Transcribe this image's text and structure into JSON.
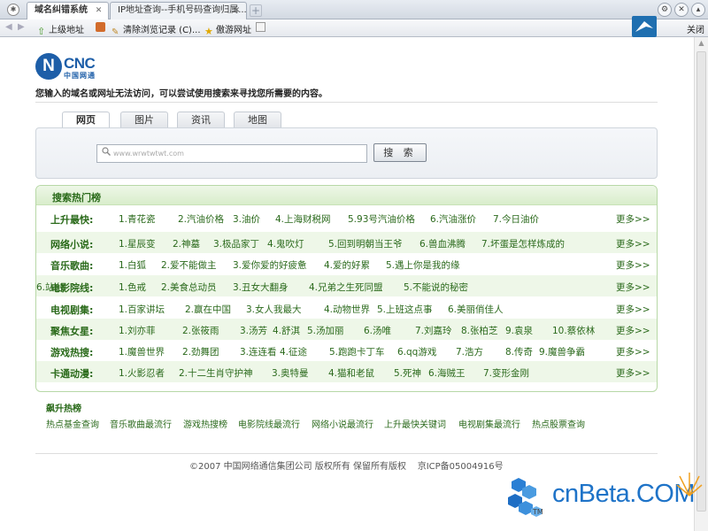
{
  "browser": {
    "tabs": [
      {
        "label": "域名纠错系统",
        "active": true
      },
      {
        "label": "IP地址查询--手机号码查询归属...",
        "active": false
      }
    ],
    "toolbar": {
      "items": [
        "上级地址",
        "清除浏览记录 (C)...",
        "傲游网址"
      ],
      "close_label": "关闭"
    }
  },
  "page": {
    "logo": {
      "mark": "N",
      "brand": "CNC",
      "cn": "中国网通"
    },
    "notice": "您输入的域名或网址无法访问，可以尝试使用搜索来寻找您所需要的内容。",
    "search": {
      "tabs": [
        "网页",
        "图片",
        "资讯",
        "地图"
      ],
      "active_tab": "网页",
      "input_value": "www.wrwtwtwt.com",
      "button_label": "搜 索"
    },
    "hot": {
      "title": "搜索热门榜",
      "more_label": "更多>>",
      "rows": [
        {
          "label": "上升最快:",
          "items": [
            "1.青花瓷",
            "2.汽油价格",
            "3.油价",
            "4.上海财税网",
            "5.93号汽油价格",
            "6.汽油涨价",
            "7.今日油价"
          ]
        },
        {
          "label": "网络小说:",
          "items": [
            "1.星辰变",
            "2.神墓",
            "3.极品家丁",
            "4.鬼吹灯",
            "5.回到明朝当王爷",
            "6.兽血沸腾",
            "7.坏蛋是怎样炼成的"
          ]
        },
        {
          "label": "音乐歌曲:",
          "items": [
            "1.白狐",
            "2.爱不能做主",
            "3.爱你爱的好疲惫",
            "4.爱的好累",
            "5.遇上你是我的缘"
          ]
        },
        {
          "label": "电影院线:",
          "items": [
            "1.色戒",
            "2.美食总动员",
            "3.丑女大翻身",
            "4.兄弟之生死同盟",
            "5.不能说的秘密",
            "6.站台"
          ]
        },
        {
          "label": "电视剧集:",
          "items": [
            "1.百家讲坛",
            "2.赢在中国",
            "3.女人我最大",
            "4.动物世界",
            "5.上班这点事",
            "6.美丽俏佳人"
          ]
        },
        {
          "label": "聚焦女星:",
          "items": [
            "1.刘亦菲",
            "2.张筱雨",
            "3.汤芳",
            "4.舒淇",
            "5.汤加丽",
            "6.汤唯",
            "7.刘嘉玲",
            "8.张柏芝",
            "9.袁泉",
            "10.蔡依林"
          ]
        },
        {
          "label": "游戏热搜:",
          "items": [
            "1.魔兽世界",
            "2.劲舞团",
            "3.连连看",
            "4.征途",
            "5.跑跑卡丁车",
            "6.qq游戏",
            "7.浩方",
            "8.传奇",
            "9.魔兽争霸"
          ]
        },
        {
          "label": "卡通动漫:",
          "items": [
            "1.火影忍者",
            "2.十二生肖守护神",
            "3.奥特曼",
            "4.猫和老鼠",
            "5.死神",
            "6.海贼王",
            "7.变形金刚"
          ]
        }
      ]
    },
    "rising": {
      "title": "飙升热榜",
      "links": [
        "热点基金查询",
        "音乐歌曲最流行",
        "游戏热搜榜",
        "电影院线最流行",
        "网络小说最流行",
        "上升最快关键词",
        "电视剧集最流行",
        "热点股票查询"
      ]
    },
    "footer": {
      "copyright": "©2007 中国网络通信集团公司 版权所有 保留所有版权",
      "icp": "京ICP备05004916号"
    }
  },
  "watermark": {
    "text": "cnBeta.COM",
    "tm": "TM"
  }
}
